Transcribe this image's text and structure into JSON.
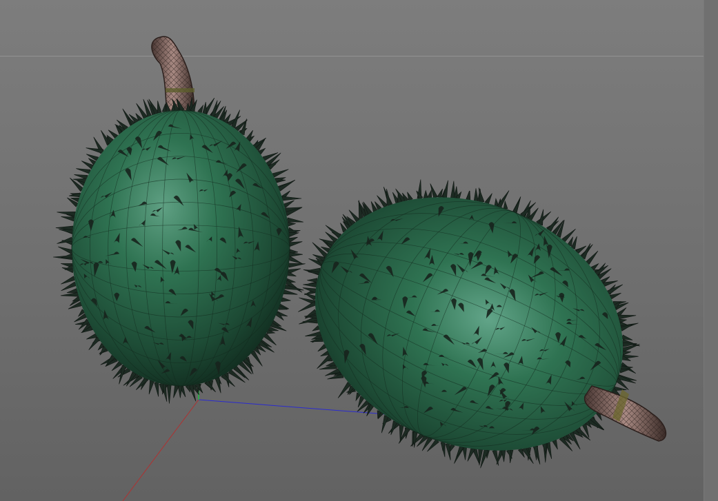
{
  "viewport": {
    "background_top": "#7d7d7d",
    "background_bottom": "#626262",
    "horizon_color": "#929292"
  },
  "axes": {
    "x_axis_color": "#b03030",
    "y_axis_color": "#2fa84a",
    "z_axis_color": "#2a2ad0"
  },
  "objects": [
    {
      "name": "soursop-fruit-upright",
      "skin_color": "#2e6a4c",
      "stem_color": "#8c6e66"
    },
    {
      "name": "soursop-fruit-lying",
      "skin_color": "#2e6a4c",
      "stem_color": "#8c6e66"
    }
  ]
}
